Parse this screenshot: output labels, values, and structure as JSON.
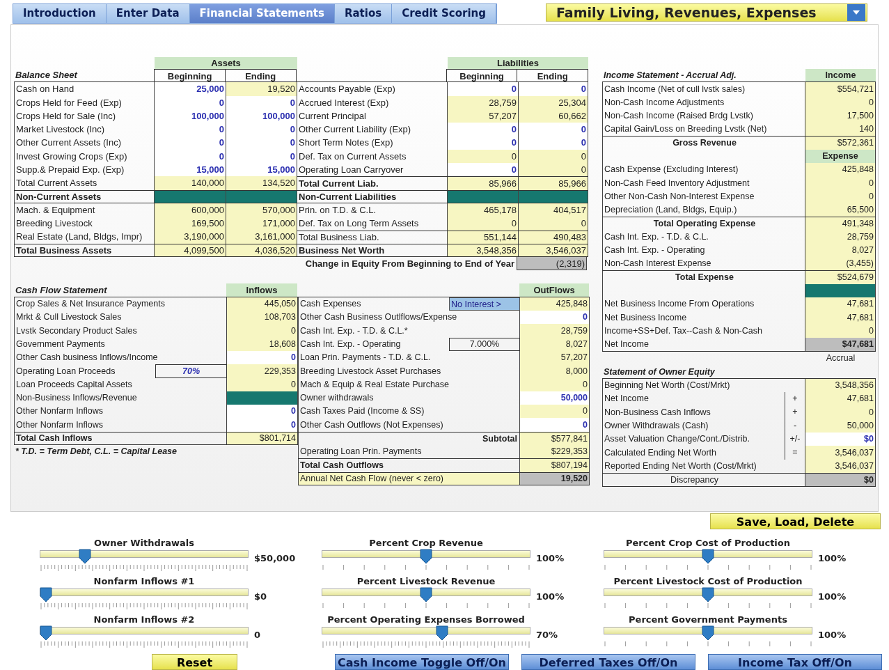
{
  "tabs": [
    {
      "label": "Introduction",
      "selected": false
    },
    {
      "label": "Enter Data",
      "selected": false
    },
    {
      "label": "Financial Statements",
      "selected": true
    },
    {
      "label": "Ratios",
      "selected": false
    },
    {
      "label": "Credit Scoring",
      "selected": false
    }
  ],
  "view_select": {
    "value": "Family Living, Revenues, Expenses"
  },
  "balance_sheet": {
    "title": "Balance Sheet",
    "assets_heading": "Assets",
    "liabilities_heading": "Liabilities",
    "columns": [
      "Beginning",
      "Ending",
      "Beginning",
      "Ending"
    ],
    "rows": [
      {
        "left": {
          "label": "Cash on Hand",
          "kind": "item",
          "bold": false,
          "cells": [
            {
              "text": "25,000",
              "kind": "input"
            },
            {
              "text": "19,520",
              "kind": "calc"
            }
          ]
        },
        "right": {
          "label": "Accounts Payable (Exp)",
          "kind": "item",
          "bold": false,
          "cells": [
            {
              "text": "0",
              "kind": "input"
            },
            {
              "text": "0",
              "kind": "input"
            }
          ]
        }
      },
      {
        "left": {
          "label": "Crops Held for Feed (Exp)",
          "kind": "item",
          "bold": false,
          "cells": [
            {
              "text": "0",
              "kind": "input"
            },
            {
              "text": "0",
              "kind": "input"
            }
          ]
        },
        "right": {
          "label": "Accrued Interest (Exp)",
          "kind": "item",
          "bold": false,
          "cells": [
            {
              "text": "28,759",
              "kind": "calc"
            },
            {
              "text": "25,304",
              "kind": "calc"
            }
          ]
        }
      },
      {
        "left": {
          "label": "Crops Held for Sale (Inc)",
          "kind": "item",
          "bold": false,
          "cells": [
            {
              "text": "100,000",
              "kind": "input"
            },
            {
              "text": "100,000",
              "kind": "input"
            }
          ]
        },
        "right": {
          "label": "Current Principal",
          "kind": "item",
          "bold": false,
          "cells": [
            {
              "text": "57,207",
              "kind": "calc"
            },
            {
              "text": "60,662",
              "kind": "calc"
            }
          ]
        }
      },
      {
        "left": {
          "label": "Market Livestock (Inc)",
          "kind": "item",
          "bold": false,
          "cells": [
            {
              "text": "0",
              "kind": "input"
            },
            {
              "text": "0",
              "kind": "input"
            }
          ]
        },
        "right": {
          "label": "Other Current Liability (Exp)",
          "kind": "item",
          "bold": false,
          "cells": [
            {
              "text": "0",
              "kind": "input"
            },
            {
              "text": "0",
              "kind": "input"
            }
          ]
        }
      },
      {
        "left": {
          "label": "Other Current Assets (Inc)",
          "kind": "item",
          "bold": false,
          "cells": [
            {
              "text": "0",
              "kind": "input"
            },
            {
              "text": "0",
              "kind": "input"
            }
          ]
        },
        "right": {
          "label": "Short Term Notes (Exp)",
          "kind": "item",
          "bold": false,
          "cells": [
            {
              "text": "0",
              "kind": "input"
            },
            {
              "text": "0",
              "kind": "input"
            }
          ]
        }
      },
      {
        "left": {
          "label": "Invest Growing Crops (Exp)",
          "kind": "item",
          "bold": false,
          "cells": [
            {
              "text": "0",
              "kind": "input"
            },
            {
              "text": "0",
              "kind": "input"
            }
          ]
        },
        "right": {
          "label": "Def. Tax on Current Assets",
          "kind": "item",
          "bold": false,
          "cells": [
            {
              "text": "0",
              "kind": "calc"
            },
            {
              "text": "0",
              "kind": "calc"
            }
          ]
        }
      },
      {
        "left": {
          "label": "Supp.& Prepaid Exp. (Exp)",
          "kind": "item",
          "bold": false,
          "cells": [
            {
              "text": "15,000",
              "kind": "input"
            },
            {
              "text": "15,000",
              "kind": "input"
            }
          ]
        },
        "right": {
          "label": "Operating Loan Carryover",
          "kind": "item",
          "bold": false,
          "cells": [
            {
              "text": "0",
              "kind": "input"
            },
            {
              "text": "0",
              "kind": "calc"
            }
          ]
        }
      },
      {
        "left": {
          "label": "Total Current Assets",
          "kind": "item",
          "bold": false,
          "cells": [
            {
              "text": "140,000",
              "kind": "calc"
            },
            {
              "text": "134,520",
              "kind": "calc"
            }
          ]
        },
        "right": {
          "label": "Total Current Liab.",
          "kind": "total",
          "bold": true,
          "cells": [
            {
              "text": "85,966",
              "kind": "calc"
            },
            {
              "text": "85,966",
              "kind": "calc"
            }
          ]
        }
      },
      {
        "left": {
          "label": "Non-Current Assets",
          "kind": "section",
          "bold": true,
          "cells": [
            {
              "kind": "band"
            },
            {
              "kind": "band"
            }
          ]
        },
        "right": {
          "label": "Non-Current Liabilities",
          "kind": "section",
          "bold": true,
          "cells": [
            {
              "kind": "band"
            },
            {
              "kind": "band"
            }
          ]
        }
      },
      {
        "left": {
          "label": "Mach. & Equipment",
          "kind": "item",
          "bold": false,
          "cells": [
            {
              "text": "600,000",
              "kind": "calc"
            },
            {
              "text": "570,000",
              "kind": "calc"
            }
          ]
        },
        "right": {
          "label": "Prin. on T.D. & C.L.",
          "kind": "item",
          "bold": false,
          "cells": [
            {
              "text": "465,178",
              "kind": "calc"
            },
            {
              "text": "404,517",
              "kind": "calc"
            }
          ]
        }
      },
      {
        "left": {
          "label": "Breeding Livestock",
          "kind": "item",
          "bold": false,
          "cells": [
            {
              "text": "169,500",
              "kind": "calc"
            },
            {
              "text": "171,000",
              "kind": "calc"
            }
          ]
        },
        "right": {
          "label": "Def. Tax on Long Term Assets",
          "kind": "item",
          "bold": false,
          "cells": [
            {
              "text": "0",
              "kind": "calc"
            },
            {
              "text": "0",
              "kind": "calc"
            }
          ]
        }
      },
      {
        "left": {
          "label": "Real Estate (Land, Bldgs, Impr)",
          "kind": "item",
          "bold": false,
          "cells": [
            {
              "text": "3,190,000",
              "kind": "calc"
            },
            {
              "text": "3,161,000",
              "kind": "calc"
            }
          ]
        },
        "right": {
          "label": "Total Business Liab.",
          "kind": "total",
          "bold": false,
          "cells": [
            {
              "text": "551,144",
              "kind": "calc"
            },
            {
              "text": "490,483",
              "kind": "calc"
            }
          ]
        }
      },
      {
        "left": {
          "label": "Total Business Assets",
          "kind": "total",
          "bold": true,
          "cells": [
            {
              "text": "4,099,500",
              "kind": "calc"
            },
            {
              "text": "4,036,520",
              "kind": "calc"
            }
          ]
        },
        "right": {
          "label": "Business Net Worth",
          "kind": "total",
          "bold": true,
          "cells": [
            {
              "text": "3,548,356",
              "kind": "calc"
            },
            {
              "text": "3,546,037",
              "kind": "calc"
            }
          ]
        }
      }
    ],
    "change": {
      "label": "Change in Equity From Beginning to End of Year",
      "cell": {
        "text": "(2,319)",
        "kind": "sum"
      }
    }
  },
  "cash_flow": {
    "title": "Cash Flow Statement",
    "inflows_heading": "Inflows",
    "outflows_heading": "OutFlows",
    "footnote": "* T.D. = Term Debt, C.L. = Capital Lease",
    "inflows": [
      {
        "label": "Crop Sales & Net Insurance Payments",
        "kind": "item",
        "cell": {
          "text": "445,050",
          "kind": "calc"
        }
      },
      {
        "label": "Mrkt & Cull Livestock Sales",
        "kind": "item",
        "cell": {
          "text": "108,703",
          "kind": "calc"
        }
      },
      {
        "label": "Lvstk Secondary Product Sales",
        "kind": "item",
        "cell": {
          "text": "0",
          "kind": "calc"
        }
      },
      {
        "label": "Government Payments",
        "kind": "item",
        "cell": {
          "text": "18,608",
          "kind": "calc"
        }
      },
      {
        "label": "Other Cash business Inflows/Income",
        "kind": "item",
        "cell": {
          "text": "0",
          "kind": "input"
        }
      },
      {
        "label": "Operating Loan Proceeds",
        "kind": "item",
        "extra": {
          "kind": "field",
          "text": "70%"
        },
        "cell": {
          "text": "229,353",
          "kind": "calc"
        }
      },
      {
        "label": "Loan Proceeds Capital Assets",
        "kind": "item",
        "cell": {
          "text": "0",
          "kind": "calc"
        }
      },
      {
        "label": "Non-Business Inflows/Revenue",
        "kind": "item",
        "cell": {
          "kind": "band"
        }
      },
      {
        "label": "Other Nonfarm Inflows",
        "kind": "item",
        "cell": {
          "text": "0",
          "kind": "input"
        }
      },
      {
        "label": "Other Nonfarm Inflows",
        "kind": "item",
        "cell": {
          "text": "0",
          "kind": "input"
        }
      },
      {
        "label": "Total Cash Inflows",
        "kind": "total",
        "cell": {
          "text": "$801,714",
          "kind": "calc"
        }
      }
    ],
    "outflows": [
      {
        "label": "Cash Expenses",
        "kind": "item",
        "extra": {
          "kind": "button",
          "text": "No Interest >"
        },
        "cell": {
          "text": "425,848",
          "kind": "calc"
        }
      },
      {
        "label": "Other Cash Business Outlflows/Expense",
        "kind": "item",
        "cell": {
          "text": "0",
          "kind": "input"
        }
      },
      {
        "label": "Cash Int. Exp. - T.D. & C.L.*",
        "kind": "item",
        "cell": {
          "text": "28,759",
          "kind": "calc"
        }
      },
      {
        "label": "Cash Int. Exp. - Operating",
        "kind": "item",
        "extra": {
          "kind": "field",
          "text": "7.000%"
        },
        "cell": {
          "text": "8,027",
          "kind": "calc"
        }
      },
      {
        "label": "Loan Prin. Payments - T.D. & C.L.",
        "kind": "item",
        "cell": {
          "text": "57,207",
          "kind": "calc"
        }
      },
      {
        "label": "Breeding Livestock Asset Purchases",
        "kind": "item",
        "cell": {
          "text": "8,000",
          "kind": "calc"
        }
      },
      {
        "label": "Mach & Equip & Real Estate Purchase",
        "kind": "item",
        "cell": {
          "text": "0",
          "kind": "calc"
        }
      },
      {
        "label": "Owner withdrawals",
        "kind": "item",
        "cell": {
          "text": "50,000",
          "kind": "input"
        }
      },
      {
        "label": "Cash Taxes Paid (Income & SS)",
        "kind": "item",
        "cell": {
          "text": "0",
          "kind": "calc"
        }
      },
      {
        "label": "Other Cash Outflows (Not Expenses)",
        "kind": "item",
        "cell": {
          "text": "0",
          "kind": "input"
        }
      },
      {
        "label": "Subtotal",
        "kind": "subtotal",
        "cell": {
          "text": "$577,841",
          "kind": "calc"
        }
      },
      {
        "label": "Operating Loan Prin. Payments",
        "kind": "item",
        "cell": {
          "text": "$229,353",
          "kind": "calc"
        }
      },
      {
        "label": "Total Cash Outflows",
        "kind": "total",
        "cell": {
          "text": "$807,194",
          "kind": "calc"
        }
      },
      {
        "label": "Annual Net Cash Flow (never < zero)",
        "kind": "net",
        "cell": {
          "text": "19,520",
          "kind": "sum"
        }
      }
    ]
  },
  "income_statement": {
    "title": "Income Statement - Accrual Adj.",
    "heading": "Income",
    "rows": [
      {
        "kind": "item",
        "label": "Cash Income (Net of cull lvstk sales)",
        "cell": {
          "text": "$554,721",
          "kind": "calc"
        }
      },
      {
        "kind": "item",
        "label": "Non-Cash Income Adjustments",
        "cell": {
          "text": "0",
          "kind": "calc"
        }
      },
      {
        "kind": "item",
        "label": "Non-Cash Income (Raised Brdg Lvstk)",
        "cell": {
          "text": "17,500",
          "kind": "calc"
        }
      },
      {
        "kind": "item",
        "label": "Capital Gain/Loss on Breeding Lvstk (Net)",
        "cell": {
          "text": "140",
          "kind": "calc"
        }
      },
      {
        "kind": "total",
        "label": "Gross Revenue",
        "cell": {
          "text": "$572,361",
          "kind": "calc"
        }
      },
      {
        "kind": "heading",
        "label": "Expense"
      },
      {
        "kind": "item",
        "label": "Cash Expense (Excluding Interest)",
        "cell": {
          "text": "425,848",
          "kind": "calc"
        }
      },
      {
        "kind": "item",
        "label": "Non-Cash Feed Inventory Adjustment",
        "cell": {
          "text": "0",
          "kind": "calc"
        }
      },
      {
        "kind": "item",
        "label": "Other Non-Cash Non-Interest Expense",
        "cell": {
          "text": "0",
          "kind": "calc"
        }
      },
      {
        "kind": "item",
        "label": "Depreciation (Land, Bldgs, Equip.)",
        "cell": {
          "text": "65,500",
          "kind": "calc"
        }
      },
      {
        "kind": "total",
        "label": "Total Operating Expense",
        "cell": {
          "text": "491,348",
          "kind": "calc"
        }
      },
      {
        "kind": "item",
        "label": "Cash Int. Exp. - T.D. & C.L.",
        "cell": {
          "text": "28,759",
          "kind": "calc"
        }
      },
      {
        "kind": "item",
        "label": "Cash Int. Exp. - Operating",
        "cell": {
          "text": "8,027",
          "kind": "calc"
        }
      },
      {
        "kind": "item",
        "label": "Non-Cash Interest Expense",
        "cell": {
          "text": "(3,455)",
          "kind": "calc"
        }
      },
      {
        "kind": "total",
        "label": "Total Expense",
        "cell": {
          "text": "$524,679",
          "kind": "calc"
        }
      },
      {
        "kind": "band",
        "cell": {
          "kind": "band"
        }
      },
      {
        "kind": "item",
        "label": "Net Business Income From Operations",
        "cell": {
          "text": "47,681",
          "kind": "calc"
        }
      },
      {
        "kind": "item",
        "label": "Net Business Income",
        "cell": {
          "text": "47,681",
          "kind": "calc"
        }
      },
      {
        "kind": "item",
        "label": "Income+SS+Def. Tax--Cash & Non-Cash",
        "cell": {
          "text": "0",
          "kind": "calc"
        }
      },
      {
        "kind": "item",
        "label": "Net Income",
        "cell": {
          "text": "$47,681",
          "kind": "sum"
        }
      }
    ],
    "basis": "Accrual"
  },
  "owner_equity": {
    "title": "Statement of Owner Equity",
    "rows": [
      {
        "kind": "item",
        "label": "Beginning Net Worth (Cost/Mrkt)",
        "cell": {
          "text": "3,548,356",
          "kind": "calc"
        }
      },
      {
        "kind": "item",
        "label": "Net Income",
        "op": "+",
        "cell": {
          "text": "47,681",
          "kind": "calc"
        }
      },
      {
        "kind": "item",
        "label": "Non-Business Cash Inflows",
        "op": "+",
        "cell": {
          "text": "0",
          "kind": "calc"
        }
      },
      {
        "kind": "item",
        "label": "Owner Withdrawals (Cash)",
        "op": "-",
        "cell": {
          "text": "50,000",
          "kind": "calc"
        }
      },
      {
        "kind": "item",
        "label": "Asset Valuation Change/Cont./Distrib.",
        "op": "+/-",
        "cell": {
          "text": "$0",
          "kind": "input"
        }
      },
      {
        "kind": "item",
        "label": "Calculated Ending Net Worth",
        "op": "=",
        "cell": {
          "text": "3,546,037",
          "kind": "calc"
        }
      },
      {
        "kind": "item",
        "label": "Reported Ending Net Worth (Cost/Mrkt)",
        "cell": {
          "text": "3,546,037",
          "kind": "calc"
        }
      },
      {
        "kind": "result",
        "label": "Discrepancy",
        "cell": {
          "text": "$0",
          "kind": "sum"
        }
      }
    ]
  },
  "save_button": {
    "label": "Save, Load, Delete"
  },
  "sliders": [
    [
      {
        "label": "Owner Withdrawals",
        "value": "$50,000",
        "level": 0.2,
        "kind": "fine"
      },
      {
        "label": "Nonfarm Inflows #1",
        "value": "$0",
        "level": 0,
        "kind": "fine"
      },
      {
        "label": "Nonfarm Inflows #2",
        "value": "0",
        "level": 0,
        "kind": "fine"
      }
    ],
    [
      {
        "label": "Percent Crop Revenue",
        "value": "100%",
        "level": 0.5,
        "kind": "coarse"
      },
      {
        "label": "Percent Livestock Revenue",
        "value": "100%",
        "level": 0.5,
        "kind": "coarse"
      },
      {
        "label": "Percent Operating Expenses Borrowed",
        "value": "70%",
        "level": 0.58,
        "kind": "fine"
      }
    ],
    [
      {
        "label": "Percent Crop Cost of Production",
        "value": "100%",
        "level": 0.5,
        "kind": "coarse"
      },
      {
        "label": "Percent Livestock Cost of Production",
        "value": "100%",
        "level": 0.5,
        "kind": "coarse"
      },
      {
        "label": "Percent Government Payments",
        "value": "100%",
        "level": 0.5,
        "kind": "coarse"
      }
    ]
  ],
  "buttons": [
    {
      "label": "Reset",
      "kind": "yellow"
    },
    {
      "label": "Cash Income Toggle Off/On",
      "kind": "blue"
    },
    {
      "label": "Deferred Taxes Off/On",
      "kind": "blue"
    },
    {
      "label": "Income Tax Off/On",
      "kind": "blue"
    }
  ]
}
